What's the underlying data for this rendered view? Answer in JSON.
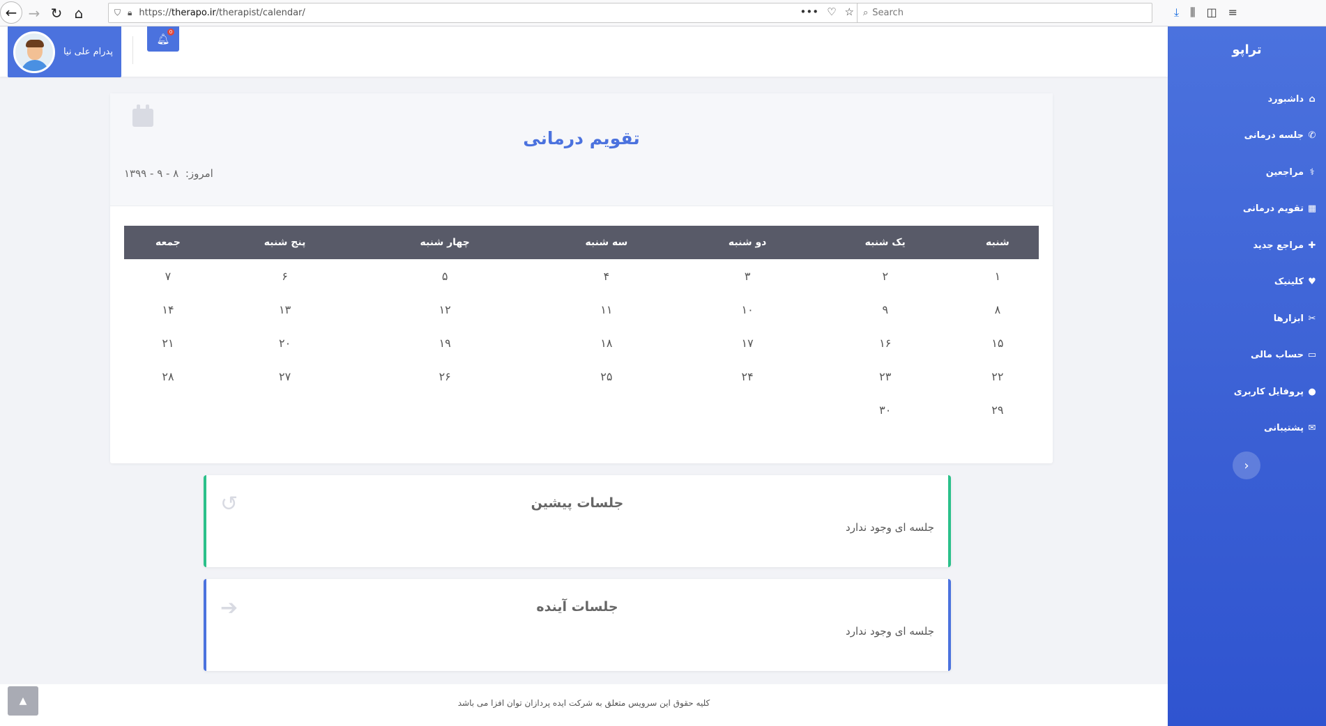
{
  "browser": {
    "url_prefix": "https://",
    "url_host": "therapo.ir",
    "url_path": "/therapist/calendar/",
    "search_placeholder": "Search",
    "more_glyph": "•••"
  },
  "sidebar": {
    "brand": "تراپو",
    "items": [
      {
        "label": "داشبورد",
        "icon": "⌂"
      },
      {
        "label": "جلسه درمانی",
        "icon": "✆"
      },
      {
        "label": "مراجعین",
        "icon": "⚕"
      },
      {
        "label": "تقویم درمانی",
        "icon": "▦"
      },
      {
        "label": "مراجع جدید",
        "icon": "✚"
      },
      {
        "label": "کلینیک",
        "icon": "♥"
      },
      {
        "label": "ابزارها",
        "icon": "✂"
      },
      {
        "label": "حساب مالی",
        "icon": "▭"
      },
      {
        "label": "پروفایل کاربری",
        "icon": "●"
      },
      {
        "label": "پشتیبانی",
        "icon": "✉"
      }
    ],
    "collapse_glyph": "‹"
  },
  "header": {
    "user_name": "پدرام علی نیا",
    "notification_count": "0"
  },
  "calendar": {
    "title": "تقویم درمانی",
    "today_label": "امروز:",
    "today_value": "۸ - ۹ - ۱۳۹۹",
    "weekdays": [
      "شنبه",
      "یک شنبه",
      "دو شنبه",
      "سه شنبه",
      "چهار شنبه",
      "پنج شنبه",
      "جمعه"
    ],
    "weeks": [
      [
        "۱",
        "۲",
        "۳",
        "۴",
        "۵",
        "۶",
        "۷"
      ],
      [
        "۸",
        "۹",
        "۱۰",
        "۱۱",
        "۱۲",
        "۱۳",
        "۱۴"
      ],
      [
        "۱۵",
        "۱۶",
        "۱۷",
        "۱۸",
        "۱۹",
        "۲۰",
        "۲۱"
      ],
      [
        "۲۲",
        "۲۳",
        "۲۴",
        "۲۵",
        "۲۶",
        "۲۷",
        "۲۸"
      ],
      [
        "۲۹",
        "۳۰",
        "",
        "",
        "",
        "",
        ""
      ]
    ]
  },
  "past_sessions": {
    "title": "جلسات پیشین",
    "empty_text": "جلسه ای وجود ندارد"
  },
  "future_sessions": {
    "title": "جلسات آینده",
    "empty_text": "جلسه ای وجود ندارد"
  },
  "footer": {
    "text": "کلیه حقوق این سرویس متعلق به شرکت ایده پردازان توان افزا می باشد"
  },
  "colors": {
    "accent": "#4b72de",
    "past_border": "#2bc08a",
    "table_header": "#585a68"
  }
}
